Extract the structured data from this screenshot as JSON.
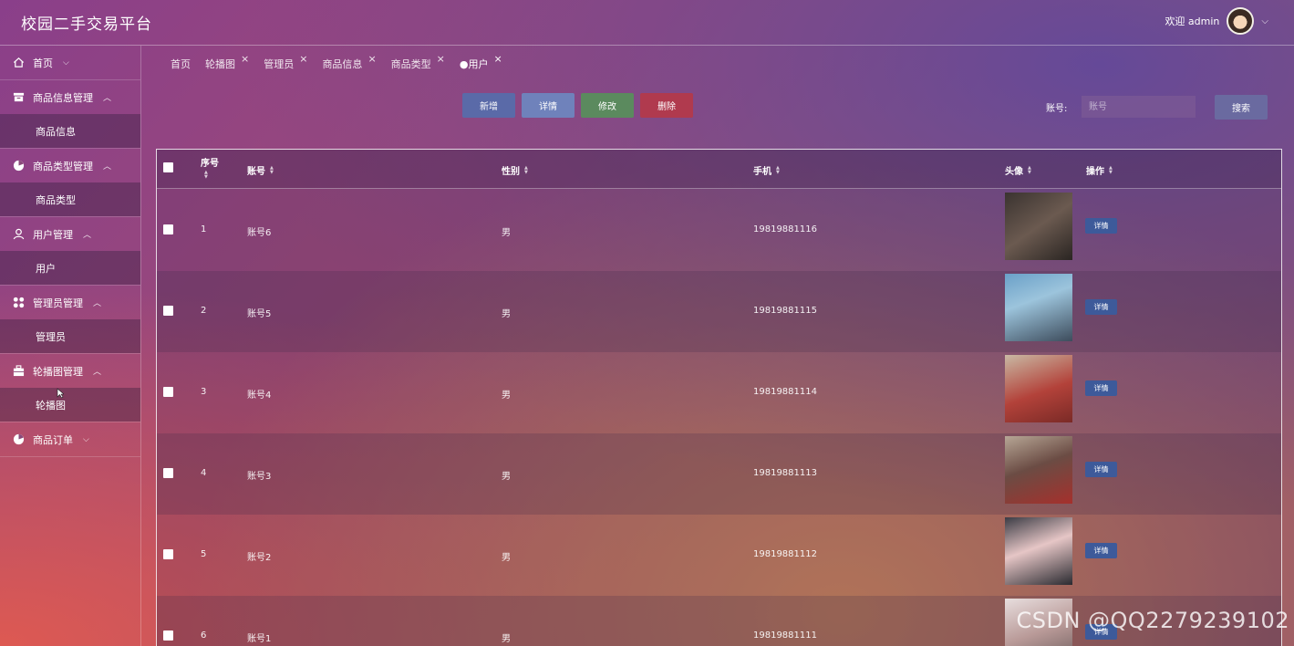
{
  "app": {
    "title": "校园二手交易平台"
  },
  "header": {
    "welcome": "欢迎 admin"
  },
  "sidebar": {
    "groups": [
      {
        "label": "首页",
        "icon": "home-icon",
        "sub": null
      },
      {
        "label": "商品信息管理",
        "icon": "inbox-icon",
        "sub": "商品信息"
      },
      {
        "label": "商品类型管理",
        "icon": "pie-chart-icon",
        "sub": "商品类型"
      },
      {
        "label": "用户管理",
        "icon": "user-icon",
        "sub": "用户"
      },
      {
        "label": "管理员管理",
        "icon": "grid-icon",
        "sub": "管理员"
      },
      {
        "label": "轮播图管理",
        "icon": "briefcase-icon",
        "sub": "轮播图"
      },
      {
        "label": "商品订单",
        "icon": "pie-chart-icon",
        "sub": null
      }
    ]
  },
  "tabs": [
    {
      "label": "首页",
      "closable": false,
      "active": false
    },
    {
      "label": "轮播图",
      "closable": true,
      "active": false
    },
    {
      "label": "管理员",
      "closable": true,
      "active": false
    },
    {
      "label": "商品信息",
      "closable": true,
      "active": false
    },
    {
      "label": "商品类型",
      "closable": true,
      "active": false
    },
    {
      "label": "●用户",
      "closable": true,
      "active": true
    }
  ],
  "toolbar": {
    "add": "新增",
    "detail": "详情",
    "edit": "修改",
    "delete": "删除",
    "search_label": "账号:",
    "search_placeholder": "账号",
    "search_button": "搜索"
  },
  "table": {
    "columns": [
      "序号",
      "账号",
      "性别",
      "手机",
      "头像",
      "操作"
    ],
    "rows": [
      {
        "index": "1",
        "account": "账号6",
        "gender": "男",
        "phone": "19819881116",
        "action": "详情"
      },
      {
        "index": "2",
        "account": "账号5",
        "gender": "男",
        "phone": "19819881115",
        "action": "详情"
      },
      {
        "index": "3",
        "account": "账号4",
        "gender": "男",
        "phone": "19819881114",
        "action": "详情"
      },
      {
        "index": "4",
        "account": "账号3",
        "gender": "男",
        "phone": "19819881113",
        "action": "详情"
      },
      {
        "index": "5",
        "account": "账号2",
        "gender": "男",
        "phone": "19819881112",
        "action": "详情"
      },
      {
        "index": "6",
        "account": "账号1",
        "gender": "男",
        "phone": "19819881111",
        "action": "详情"
      }
    ]
  },
  "watermark": "CSDN @QQ2279239102"
}
